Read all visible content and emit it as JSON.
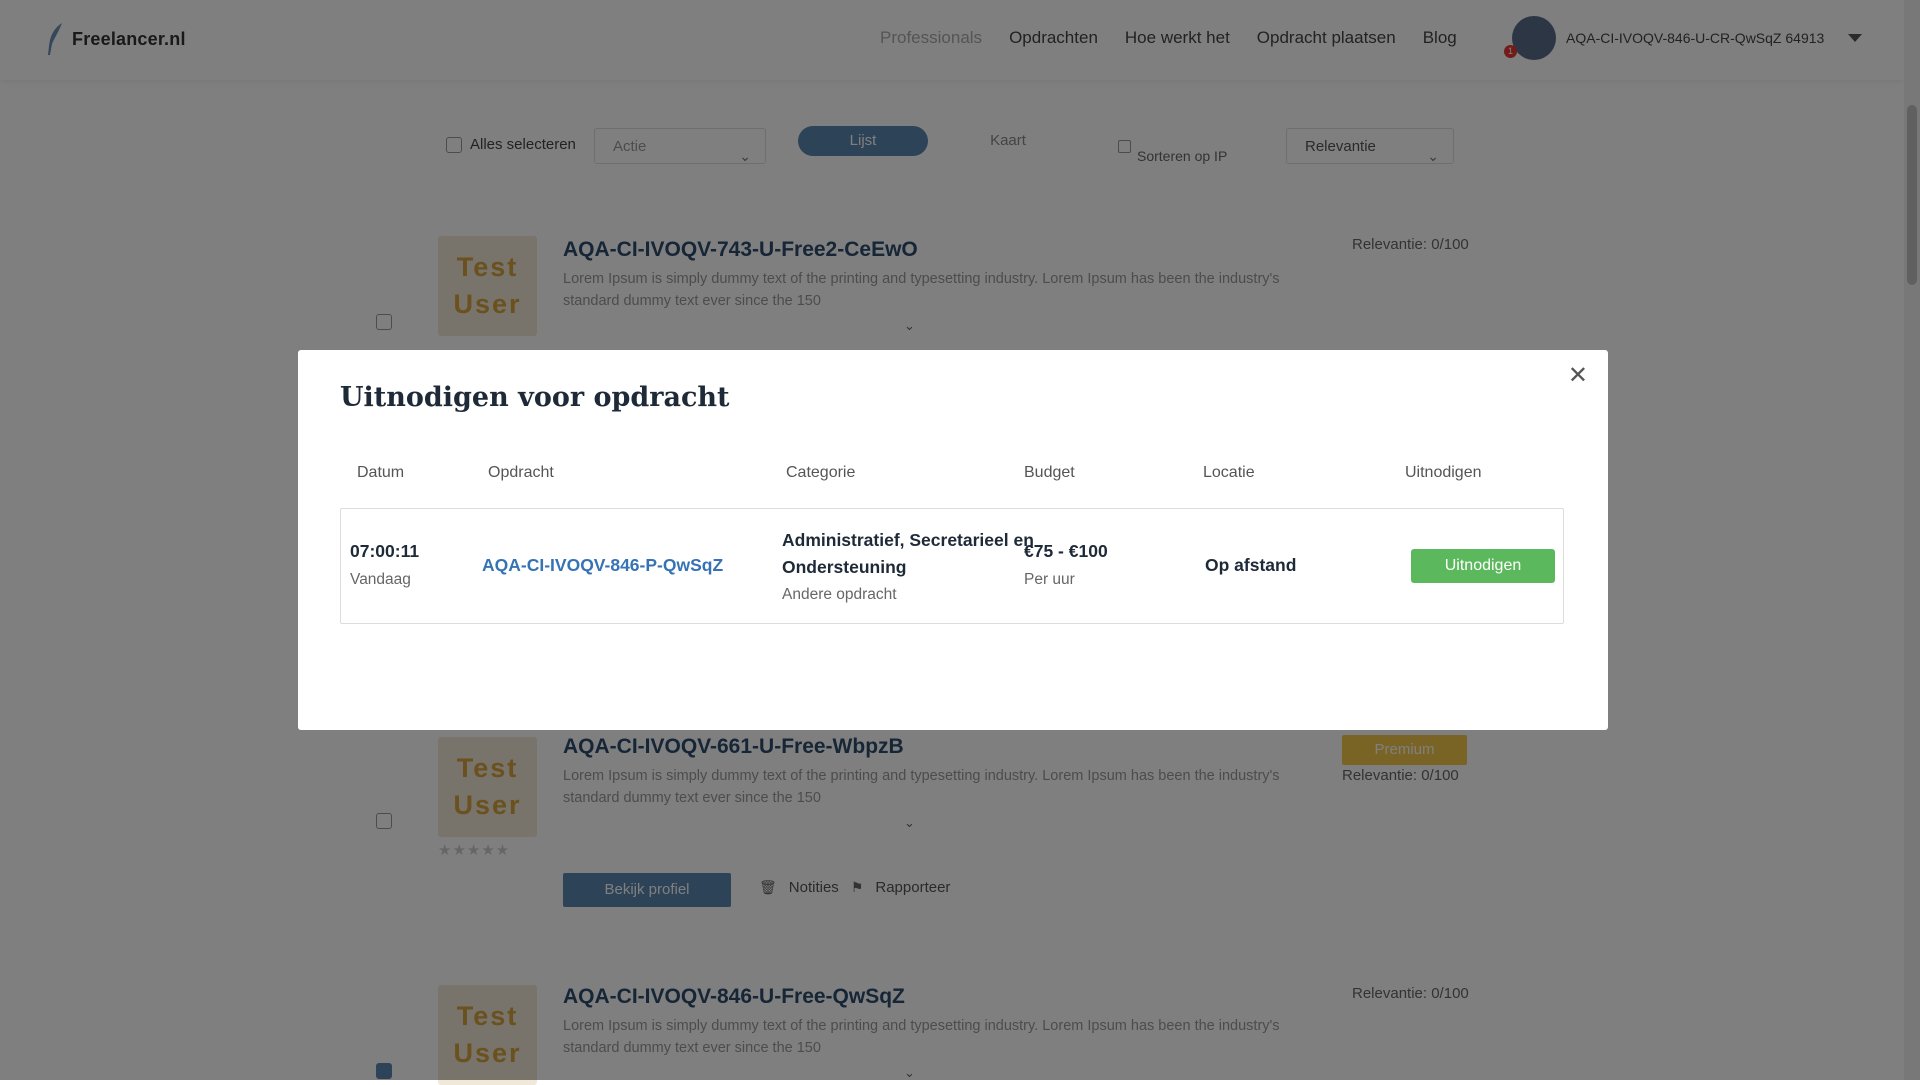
{
  "header": {
    "logo_text": "Freelancer.nl",
    "nav": [
      "Professionals",
      "Opdrachten",
      "Hoe werkt het",
      "Opdracht plaatsen",
      "Blog"
    ],
    "user_name": "AQA-CI-IVOQV-846-U-CR-QwSqZ 64913",
    "notification_count": "1"
  },
  "toolbar": {
    "select_all": "Alles selecteren",
    "action_placeholder": "Actie",
    "view_list": "Lijst",
    "view_map": "Kaart",
    "sort_ip": "Sorteren op IP",
    "sort_value": "Relevantie"
  },
  "cards": [
    {
      "avatar_text": [
        "Test",
        "User"
      ],
      "title": "AQA-CI-IVOQV-743-U-Free2-CeEwO",
      "desc": "Lorem Ipsum is simply dummy text of the printing and typesetting industry. Lorem Ipsum has been the industry's standard dummy text ever since the 150",
      "relevance": "Relevantie: 0/100"
    },
    {
      "avatar_text": [
        "Test",
        "User"
      ],
      "title": "AQA-CI-IVOQV-661-U-Free-WbpzB",
      "desc": "Lorem Ipsum is simply dummy text of the printing and typesetting industry. Lorem Ipsum has been the industry's standard dummy text ever since the 150",
      "badge": "Premium",
      "relevance": "Relevantie: 0/100",
      "view_profile": "Bekijk profiel",
      "notes": "Notities",
      "report": "Rapporteer"
    },
    {
      "avatar_text": [
        "Test",
        "User"
      ],
      "title": "AQA-CI-IVOQV-846-U-Free-QwSqZ",
      "desc": "Lorem Ipsum is simply dummy text of the printing and typesetting industry. Lorem Ipsum has been the industry's standard dummy text ever since the 150",
      "relevance": "Relevantie: 0/100"
    }
  ],
  "modal": {
    "title": "Uitnodigen voor opdracht",
    "columns": [
      "Datum",
      "Opdracht",
      "Categorie",
      "Budget",
      "Locatie",
      "Uitnodigen"
    ],
    "row": {
      "time": "07:00:11",
      "day": "Vandaag",
      "assignment": "AQA-CI-IVOQV-846-P-QwSqZ",
      "category_line1": "Administratief, Secretarieel en",
      "category_line2": "Ondersteuning",
      "category_sub": "Andere opdracht",
      "budget": "€75 - €100",
      "budget_unit": "Per uur",
      "location": "Op afstand",
      "invite_label": "Uitnodigen"
    }
  },
  "colors": {
    "primary": "#5b86b0",
    "link": "#3673b5",
    "invite_button": "#5cb85c",
    "premium": "#f2c94c"
  }
}
